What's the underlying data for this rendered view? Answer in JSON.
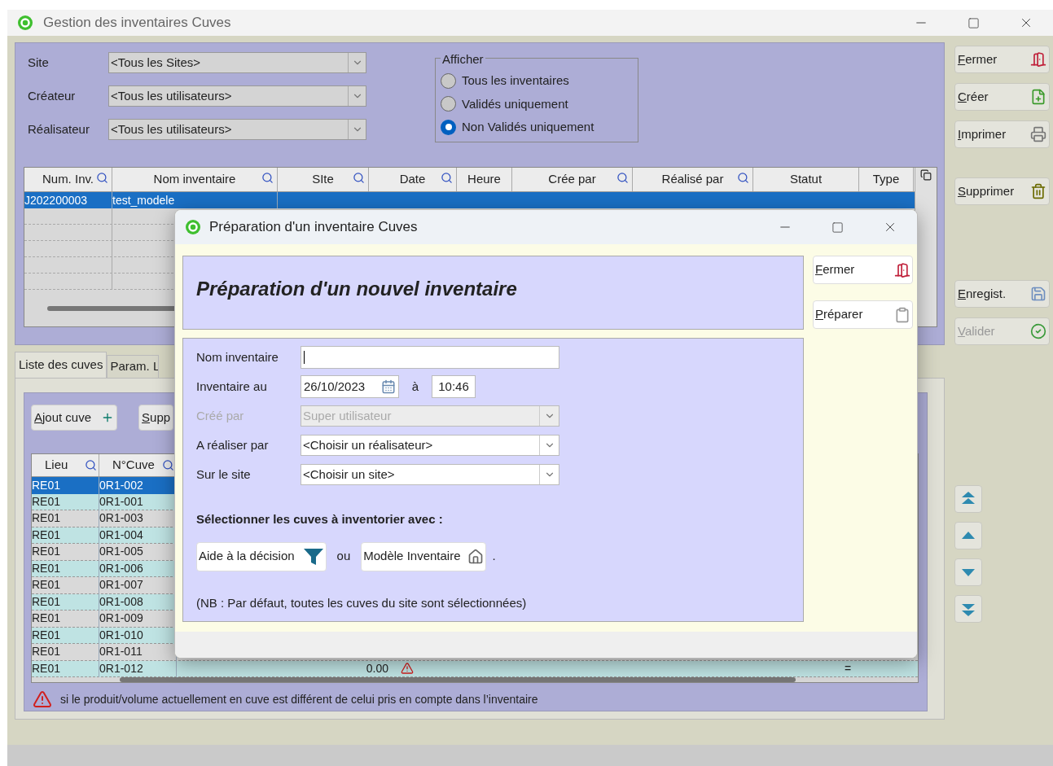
{
  "window": {
    "title": "Gestion des inventaires Cuves"
  },
  "filters": [
    {
      "label": "Site",
      "value": "<Tous les Sites>"
    },
    {
      "label": "Créateur",
      "value": "<Tous les utilisateurs>"
    },
    {
      "label": "Réalisateur",
      "value": "<Tous les utilisateurs>"
    }
  ],
  "afficher": {
    "legend": "Afficher",
    "options": [
      {
        "label": "Tous les inventaires",
        "selected": false
      },
      {
        "label": "Validés uniquement",
        "selected": false
      },
      {
        "label": "Non Validés uniquement",
        "selected": true
      }
    ]
  },
  "inventories": {
    "columns": [
      {
        "label": "Num. Inv.",
        "search": true
      },
      {
        "label": "Nom inventaire",
        "search": true
      },
      {
        "label": "SIte",
        "search": true
      },
      {
        "label": "Date",
        "search": true
      },
      {
        "label": "Heure",
        "search": false
      },
      {
        "label": "Crée par",
        "search": true
      },
      {
        "label": "Réalisé par",
        "search": true
      },
      {
        "label": "Statut",
        "search": false
      },
      {
        "label": "Type",
        "search": false
      }
    ],
    "rows": [
      {
        "cells": [
          "J202200003",
          "test_modele"
        ],
        "selected": true
      }
    ]
  },
  "actions": [
    {
      "label": "Fermer",
      "kind": "exit",
      "disabled": false
    },
    {
      "label": "Créer",
      "kind": "create",
      "disabled": false
    },
    {
      "label": "Imprimer",
      "kind": "print",
      "disabled": false
    },
    {
      "label": "Supprimer",
      "kind": "delete",
      "disabled": false
    },
    {
      "label": "Enregist.",
      "kind": "save",
      "disabled": false
    },
    {
      "label": "Valider",
      "kind": "validate",
      "disabled": true
    }
  ],
  "nav_buttons": [
    {
      "kind": "first"
    },
    {
      "kind": "up"
    },
    {
      "kind": "down"
    },
    {
      "kind": "last"
    }
  ],
  "tabs": [
    {
      "label": "Liste des cuves",
      "selected": true
    },
    {
      "label": "Param. L",
      "selected": false
    }
  ],
  "tank_buttons": [
    {
      "label": "Ajout cuve",
      "kind": "add"
    },
    {
      "label": "Supp"
    }
  ],
  "tanks": {
    "columns": [
      {
        "label": "Lieu",
        "search": true
      },
      {
        "label": "N°Cuve",
        "search": true
      }
    ],
    "rows": [
      {
        "cells": [
          "RE01",
          "0R1-002"
        ],
        "selected": true,
        "warning": false
      },
      {
        "cells": [
          "RE01",
          "0R1-001"
        ],
        "selected": false,
        "warning": false
      },
      {
        "cells": [
          "RE01",
          "0R1-003"
        ],
        "selected": false,
        "warning": false
      },
      {
        "cells": [
          "RE01",
          "0R1-004"
        ],
        "selected": false,
        "warning": false
      },
      {
        "cells": [
          "RE01",
          "0R1-005"
        ],
        "selected": false,
        "warning": false
      },
      {
        "cells": [
          "RE01",
          "0R1-006"
        ],
        "selected": false,
        "warning": false
      },
      {
        "cells": [
          "RE01",
          "0R1-007"
        ],
        "selected": false,
        "warning": false
      },
      {
        "cells": [
          "RE01",
          "0R1-008"
        ],
        "selected": false,
        "warning": false
      },
      {
        "cells": [
          "RE01",
          "0R1-009"
        ],
        "selected": false,
        "warning": false
      },
      {
        "cells": [
          "RE01",
          "0R1-010"
        ],
        "selected": false,
        "warning": false
      },
      {
        "cells": [
          "RE01",
          "0R1-011"
        ],
        "selected": false,
        "warning": false
      },
      {
        "cells": [
          "RE01",
          "0R1-012"
        ],
        "selected": false,
        "warning": true,
        "amount": "0.00",
        "sign": "="
      }
    ]
  },
  "legend_note": "si le produit/volume actuellement en cuve est différent de celui pris en compte dans l’inventaire",
  "dialog": {
    "title": "Préparation d'un inventaire Cuves",
    "heading": "Préparation d'un nouvel inventaire",
    "fields": [
      {
        "label": "Nom inventaire",
        "kind": "text",
        "disabled": false
      },
      {
        "label": "Inventaire au",
        "kind": "datetime",
        "value": "26/10/2023",
        "connector": "à",
        "time": "10:46",
        "disabled": false
      },
      {
        "label": "Créé par",
        "kind": "select",
        "value": "Super utilisateur",
        "disabled": true
      },
      {
        "label": "A réaliser par",
        "kind": "select",
        "value": "<Choisir un réalisateur>",
        "disabled": false
      },
      {
        "label": "Sur le site",
        "kind": "select",
        "value": "<Choisir un site>",
        "disabled": false
      }
    ],
    "selection_title": "Sélectionner les cuves à inventorier avec :",
    "selection_buttons": [
      {
        "label": "Aide à la décision",
        "kind": "filter"
      },
      {
        "label": "Modèle Inventaire",
        "kind": "template"
      }
    ],
    "or_text": "ou",
    "end_text": ".",
    "note": "(NB : Par défaut, toutes les cuves du site sont sélectionnées)",
    "buttons": [
      {
        "label": "Fermer",
        "kind": "exit"
      },
      {
        "label": "Préparer",
        "kind": "prepare"
      }
    ]
  }
}
